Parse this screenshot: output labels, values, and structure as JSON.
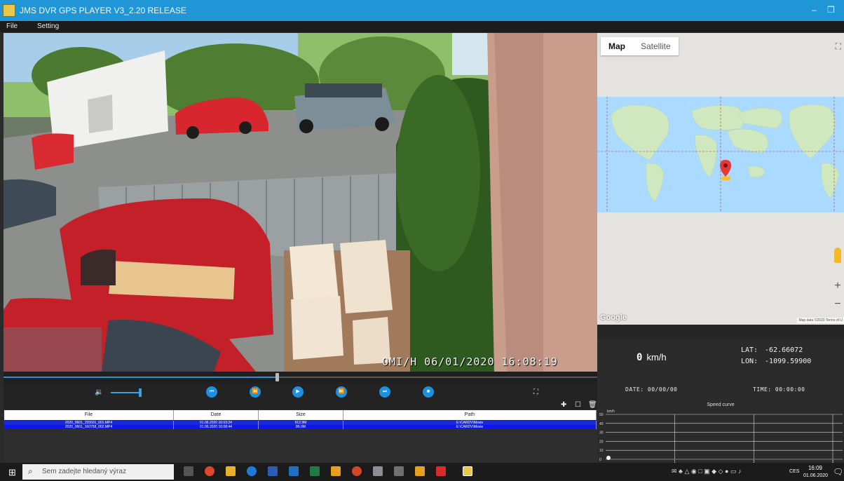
{
  "window": {
    "title": "JMS DVR GPS PLAYER V3_2.20 RELEASE",
    "minimize": "–",
    "maximize": "❐"
  },
  "menu": {
    "file": "File",
    "setting": "Setting"
  },
  "video": {
    "osd": "OMI/H 06/01/2020 16:08:19",
    "progress": 0.46,
    "volume": 0.9
  },
  "controls": {
    "prev": "⏮",
    "rewind": "⏪",
    "play": "▶",
    "forward": "⏩",
    "next": "⏭",
    "stop": "■",
    "volume_icon": "🔉",
    "fullscreen_icon": "⛶"
  },
  "list_tools": {
    "add": "✚",
    "copy": "☐",
    "delete": "🗑"
  },
  "files": {
    "headers": [
      "File",
      "Date",
      "Size",
      "Path"
    ],
    "rows": [
      [
        "2020_0601_155501_001.MP4",
        "01.06.2020 16:03:24",
        "912.9M",
        "E:\\CARDV\\Movie"
      ],
      [
        "2020_0601_160758_002.MP4",
        "01.06.2020 16:08:44",
        "86.0M",
        "E:\\CARDV\\Movie"
      ]
    ]
  },
  "map": {
    "tab_map": "Map",
    "tab_satellite": "Satellite",
    "google": "Google",
    "attribution": "Map data ©2020  Terms of U",
    "zoom_in": "+",
    "zoom_out": "−",
    "fullscreen_icon": "⛶"
  },
  "telemetry": {
    "speed_value": "0",
    "speed_unit": "km/h",
    "lat_label": "LAT:",
    "lat_value": "-62.66072",
    "lon_label": "LON:",
    "lon_value": "-1099.59900",
    "date_label": "DATE:",
    "date_value": "00/00/00",
    "time_label": "TIME:",
    "time_value": "00:00:00"
  },
  "speed_curve": {
    "title": "Speed curve",
    "unit": "km/h",
    "y_ticks": [
      "50",
      "40",
      "30",
      "20",
      "10",
      "0"
    ],
    "x_ticks": [
      "1",
      "2",
      "3"
    ]
  },
  "taskbar": {
    "start_icon": "⊞",
    "search_icon": "⌕",
    "search_placeholder": "Sem zadejte hledaný výraz",
    "tray": "✉ ♣ △ ◉ □ ▣ ◆ ◇ ● ▭ ♪",
    "lang": "CES",
    "time": "16:09",
    "date": "01.06.2020",
    "notif": "🗨"
  },
  "colors": {
    "accent": "#1e90e0",
    "titlebar": "#2196d6",
    "selection": "#1a2bd6"
  }
}
